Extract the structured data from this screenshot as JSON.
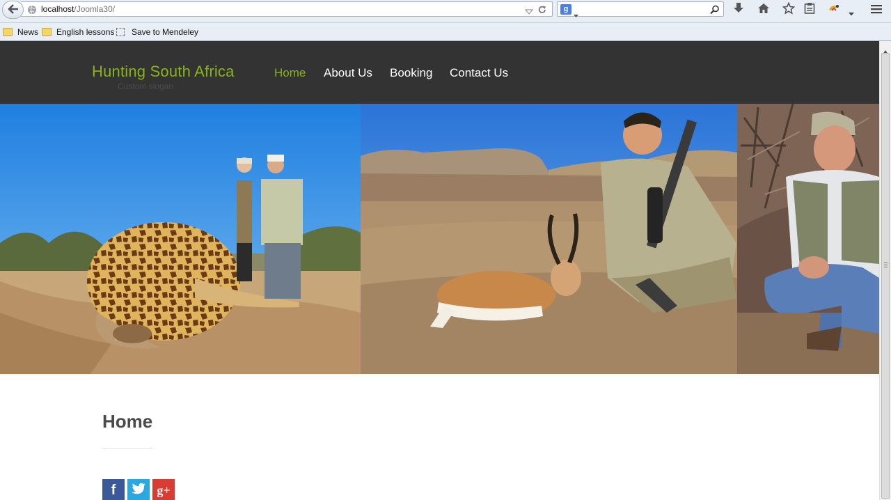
{
  "browser": {
    "url_host": "localhost",
    "url_path": "/Joomla30/",
    "search_engine_letter": "g",
    "bookmarks": [
      {
        "label": "News"
      },
      {
        "label": "English lessons"
      },
      {
        "label": "Save to Mendeley"
      }
    ]
  },
  "site": {
    "title": "Hunting South Africa",
    "slogan": "Custom slogan",
    "nav": [
      {
        "label": "Home",
        "active": true
      },
      {
        "label": "About Us",
        "active": false
      },
      {
        "label": "Booking",
        "active": false
      },
      {
        "label": "Contact Us",
        "active": false
      }
    ],
    "accent_color": "#8ab31b",
    "header_bg": "#333333"
  },
  "content": {
    "heading": "Home",
    "social": [
      {
        "name": "facebook",
        "glyph": "f",
        "color": "#3b5998"
      },
      {
        "name": "twitter",
        "glyph": "t",
        "color": "#29a9e1"
      },
      {
        "name": "google-plus",
        "glyph": "g+",
        "color": "#d73d32"
      }
    ]
  },
  "hero": {
    "photos": [
      "giraffe-hunt-photo",
      "springbok-hunt-photo",
      "hunter-portrait-photo"
    ]
  }
}
